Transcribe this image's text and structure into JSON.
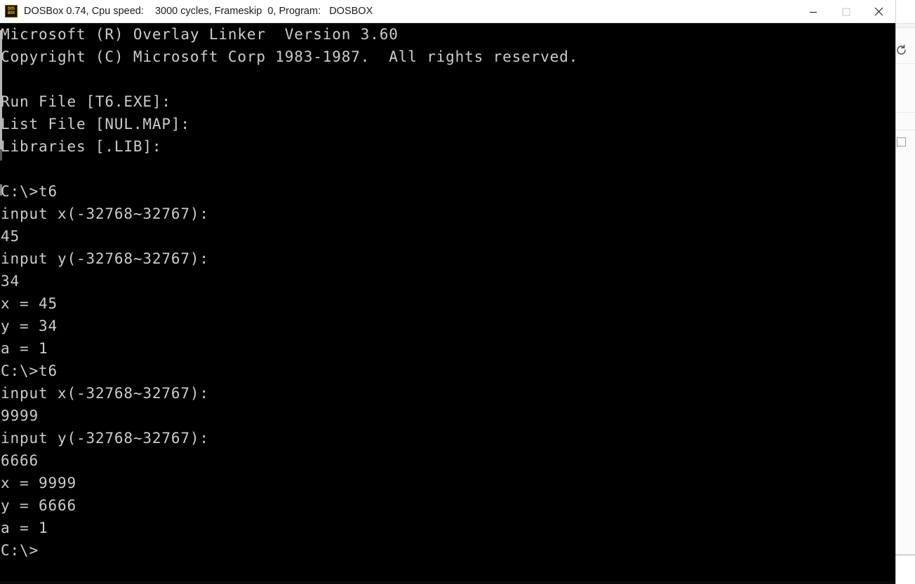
{
  "window": {
    "app_icon_line1": "DOS",
    "app_icon_line2": "BOX",
    "title": "DOSBox 0.74, Cpu speed:    3000 cycles, Frameskip  0, Program:   DOSBOX",
    "controls": {
      "minimize_label": "Minimize",
      "maximize_label": "Maximize",
      "close_label": "Close"
    },
    "colors": {
      "titlebar_background": "#ffffff",
      "titlebar_text": "#1b1b1b",
      "terminal_background": "#000000",
      "terminal_text": "#cccccc",
      "icon_accent": "#e0b020"
    }
  },
  "background_window": {
    "refresh_icon_name": "refresh-icon",
    "square_icon_name": "maximize-icon"
  },
  "terminal": {
    "lines": [
      "Microsoft (R) Overlay Linker  Version 3.60",
      "Copyright (C) Microsoft Corp 1983-1987.  All rights reserved.",
      "",
      "Run File [T6.EXE]:",
      "List File [NUL.MAP]:",
      "Libraries [.LIB]:",
      "",
      "C:\\>t6",
      "input x(-32768~32767):",
      "45",
      "input y(-32768~32767):",
      "34",
      "x = 45",
      "y = 34",
      "a = 1",
      "C:\\>t6",
      "input x(-32768~32767):",
      "9999",
      "input y(-32768~32767):",
      "6666",
      "x = 9999",
      "y = 6666",
      "a = 1",
      "C:\\>"
    ]
  }
}
